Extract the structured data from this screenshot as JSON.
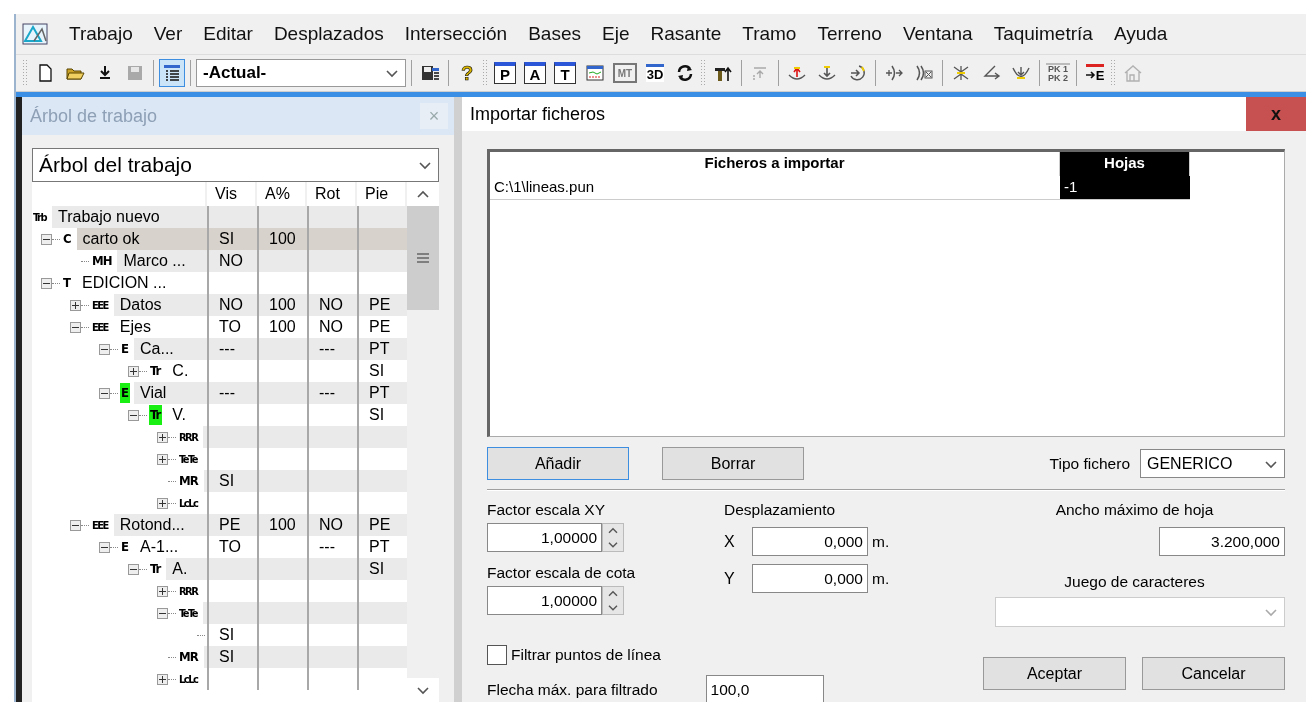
{
  "menu_bar": {
    "items": [
      "Trabajo",
      "Ver",
      "Editar",
      "Desplazados",
      "Intersección",
      "Bases",
      "Eje",
      "Rasante",
      "Tramo",
      "Terreno",
      "Ventana",
      "Taquimetría",
      "Ayuda"
    ]
  },
  "toolbar": {
    "groups": [
      {
        "grip": true,
        "items": [
          {
            "kind": "new",
            "pressed": false,
            "disabled": false
          },
          {
            "kind": "open",
            "pressed": false,
            "disabled": false
          },
          {
            "kind": "download",
            "pressed": false,
            "disabled": false
          },
          {
            "kind": "save",
            "pressed": false,
            "disabled": true
          }
        ]
      },
      {
        "grip": false,
        "items": [
          {
            "kind": "list",
            "pressed": true,
            "disabled": false
          }
        ]
      },
      {
        "grip": false,
        "combo": "-Actual-"
      },
      {
        "grip": false,
        "items": [
          {
            "kind": "database",
            "pressed": false,
            "disabled": false
          }
        ]
      },
      {
        "grip": false,
        "items": [
          {
            "kind": "help",
            "label": "?",
            "pressed": false,
            "disabled": false
          }
        ]
      },
      {
        "grip": true,
        "items": [
          {
            "kind": "tile",
            "label": "P",
            "pressed": false,
            "disabled": false
          },
          {
            "kind": "tile",
            "label": "A",
            "pressed": false,
            "disabled": false
          },
          {
            "kind": "tile",
            "label": "T",
            "pressed": false,
            "disabled": false
          },
          {
            "kind": "chart",
            "pressed": false,
            "disabled": false
          },
          {
            "kind": "grey-tile",
            "label": "MT",
            "pressed": false,
            "disabled": false
          },
          {
            "kind": "badge",
            "label": "3D",
            "pressed": false,
            "disabled": false
          },
          {
            "kind": "refresh",
            "pressed": false,
            "disabled": false
          }
        ]
      },
      {
        "grip": true,
        "items": [
          {
            "kind": "t-arrow",
            "pressed": false,
            "disabled": false
          }
        ]
      },
      {
        "grip": false,
        "items": [
          {
            "kind": "lift",
            "pressed": false,
            "disabled": true
          }
        ]
      },
      {
        "grip": false,
        "items": [
          {
            "kind": "curve-up",
            "pressed": false,
            "disabled": false
          },
          {
            "kind": "curve-down",
            "pressed": false,
            "disabled": false
          },
          {
            "kind": "curve-right",
            "pressed": false,
            "disabled": false
          }
        ]
      },
      {
        "grip": false,
        "items": [
          {
            "kind": "paren-in",
            "pressed": false,
            "disabled": false
          },
          {
            "kind": "paren-x",
            "pressed": false,
            "disabled": false
          }
        ]
      },
      {
        "grip": false,
        "items": [
          {
            "kind": "converge",
            "pressed": false,
            "disabled": false
          },
          {
            "kind": "angle",
            "pressed": false,
            "disabled": false
          },
          {
            "kind": "cup",
            "pressed": false,
            "disabled": false
          }
        ]
      },
      {
        "grip": false,
        "items": [
          {
            "kind": "pk",
            "label": "PK 1 PK 2",
            "pressed": false,
            "disabled": true
          }
        ]
      },
      {
        "grip": false,
        "items": [
          {
            "kind": "e-arrow",
            "label": "E",
            "pressed": false,
            "disabled": false
          }
        ]
      },
      {
        "grip": true,
        "items": [
          {
            "kind": "house",
            "pressed": false,
            "disabled": true
          }
        ]
      }
    ]
  },
  "panel": {
    "title": "Árbol de trabajo",
    "close": "×",
    "view_select": "Árbol del trabajo",
    "tree": {
      "columns": [
        "Vis",
        "A%",
        "Rot",
        "Pie"
      ],
      "nodes": [
        {
          "icon": "Trb",
          "name": "Trabajo nuevo",
          "selected": false,
          "highlighted": false,
          "children": [
            {
              "icon": "C",
              "name": "carto ok",
              "expanded": true,
              "selected": true,
              "highlighted": false,
              "vis": "SI",
              "a_pct": "100",
              "children": [
                {
                  "icon": "MH",
                  "name": "Marco ...",
                  "selected": false,
                  "highlighted": false,
                  "vis": "NO"
                }
              ]
            },
            {
              "icon": "T",
              "name": "EDICION ...",
              "expanded": true,
              "selected": false,
              "highlighted": false,
              "children": [
                {
                  "icon": "EEE",
                  "name": "Datos",
                  "expanded": false,
                  "selected": false,
                  "highlighted": false,
                  "vis": "NO",
                  "a_pct": "100",
                  "rot": "NO",
                  "pie": "PE"
                },
                {
                  "icon": "EEE",
                  "name": "Ejes",
                  "expanded": true,
                  "selected": false,
                  "highlighted": false,
                  "vis": "TO",
                  "a_pct": "100",
                  "rot": "NO",
                  "pie": "PE",
                  "children": [
                    {
                      "icon": "E",
                      "name": "Ca...",
                      "expanded": true,
                      "selected": false,
                      "highlighted": false,
                      "vis": "---",
                      "rot": "---",
                      "pie": "PT",
                      "children": [
                        {
                          "icon": "Tr",
                          "name": "C.",
                          "expanded": false,
                          "selected": false,
                          "highlighted": false,
                          "pie": "SI"
                        }
                      ]
                    },
                    {
                      "icon": "E",
                      "name": "Vial",
                      "expanded": true,
                      "selected": false,
                      "highlighted": true,
                      "vis": "---",
                      "rot": "---",
                      "pie": "PT",
                      "children": [
                        {
                          "icon": "Tr",
                          "name": "V.",
                          "expanded": true,
                          "selected": false,
                          "highlighted": true,
                          "pie": "SI",
                          "children": [
                            {
                              "icon": "RRR",
                              "expanded": false,
                              "selected": false,
                              "highlighted": false
                            },
                            {
                              "icon": "TeTe",
                              "expanded": false,
                              "selected": false,
                              "highlighted": false
                            },
                            {
                              "icon": "MR",
                              "selected": false,
                              "highlighted": false,
                              "vis": "SI"
                            },
                            {
                              "icon": "LcLc",
                              "expanded": false,
                              "selected": false,
                              "highlighted": false
                            }
                          ]
                        }
                      ]
                    }
                  ]
                },
                {
                  "icon": "EEE",
                  "name": "Rotond...",
                  "expanded": true,
                  "selected": false,
                  "highlighted": false,
                  "vis": "PE",
                  "a_pct": "100",
                  "rot": "NO",
                  "pie": "PE",
                  "children": [
                    {
                      "icon": "E",
                      "name": "A-1...",
                      "expanded": true,
                      "selected": false,
                      "highlighted": false,
                      "vis": "TO",
                      "rot": "---",
                      "pie": "PT",
                      "children": [
                        {
                          "icon": "Tr",
                          "name": "A.",
                          "expanded": true,
                          "selected": false,
                          "highlighted": false,
                          "pie": "SI",
                          "children": [
                            {
                              "icon": "RRR",
                              "expanded": false,
                              "selected": false,
                              "highlighted": false
                            },
                            {
                              "icon": "TeTe",
                              "expanded": true,
                              "selected": false,
                              "highlighted": false,
                              "children": [
                                {
                                  "selected": false,
                                  "vis": "SI"
                                }
                              ]
                            },
                            {
                              "icon": "MR",
                              "selected": false,
                              "highlighted": false,
                              "vis": "SI"
                            },
                            {
                              "icon": "LcLc",
                              "expanded": false,
                              "selected": false,
                              "highlighted": false
                            }
                          ]
                        }
                      ]
                    }
                  ]
                }
              ]
            }
          ]
        }
      ]
    }
  },
  "dialog": {
    "title": "Importar ficheros",
    "close": "x",
    "file_table": {
      "columns": [
        {
          "label": "Ficheros a importar",
          "selected": false
        },
        {
          "label": "Hojas",
          "selected": true
        }
      ],
      "rows": [
        {
          "file": "C:\\1\\lineas.pun",
          "sheets": "-1"
        }
      ]
    },
    "add_button": {
      "label": "Añadir",
      "focused": true
    },
    "delete_button": {
      "label": "Borrar",
      "focused": false
    },
    "file_type": {
      "label": "Tipo fichero",
      "value": "GENERICO"
    },
    "scale_xy": {
      "label": "Factor escala XY",
      "value": "1,00000"
    },
    "scale_z": {
      "label": "Factor escala de cota",
      "value": "1,00000"
    },
    "offset": {
      "label": "Desplazamiento",
      "x": {
        "label": "X",
        "value": "0,000",
        "unit": "m."
      },
      "y": {
        "label": "Y",
        "value": "0,000",
        "unit": "m."
      }
    },
    "max_width": {
      "label": "Ancho máximo de hoja",
      "value": "3.200,000"
    },
    "charset": {
      "label": "Juego de caracteres",
      "disabled": true
    },
    "filter": {
      "label": "Filtrar puntos de línea",
      "checked": false
    },
    "max_arrow": {
      "label": "Flecha máx. para filtrado",
      "value": "100,0"
    },
    "buttons": [
      {
        "label": "Aceptar"
      },
      {
        "label": "Cancelar"
      }
    ]
  }
}
